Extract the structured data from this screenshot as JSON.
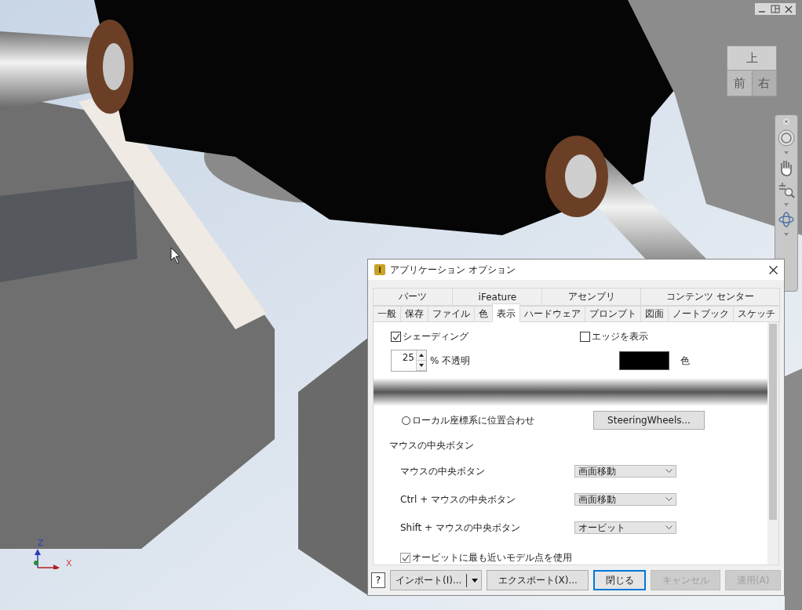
{
  "viewport": {
    "view_cube": {
      "top": "上",
      "front": "前",
      "right": "右"
    },
    "axes": {
      "z": "Z",
      "x": "X"
    }
  },
  "dialog": {
    "title": "アプリケーション オプション",
    "tab_groups": [
      {
        "label": "パーツ",
        "selected": false
      },
      {
        "label": "iFeature",
        "selected": false
      },
      {
        "label": "アセンブリ",
        "selected": false
      },
      {
        "label": "コンテンツ センター",
        "selected": false
      }
    ],
    "tabs": [
      {
        "label": "一般",
        "selected": false
      },
      {
        "label": "保存",
        "selected": false
      },
      {
        "label": "ファイル",
        "selected": false
      },
      {
        "label": "色",
        "selected": false
      },
      {
        "label": "表示",
        "selected": true
      },
      {
        "label": "ハードウェア",
        "selected": false
      },
      {
        "label": "プロンプト",
        "selected": false
      },
      {
        "label": "図面",
        "selected": false
      },
      {
        "label": "ノートブック",
        "selected": false
      },
      {
        "label": "スケッチ",
        "selected": false
      }
    ],
    "shading": {
      "label": "シェーディング",
      "checked": true
    },
    "opacity": {
      "value": "25",
      "label": "% 不透明"
    },
    "show_edges": {
      "label": "エッジを表示",
      "checked": false
    },
    "edge_color": {
      "color": "#000000",
      "label": "色"
    },
    "align_local": {
      "label": "ローカル座標系に位置合わせ",
      "selected": false
    },
    "steering_button": "SteeringWheels...",
    "middle_button_heading": "マウスの中央ボタン",
    "middle_button_rows": [
      {
        "label": "マウスの中央ボタン",
        "value": "画面移動"
      },
      {
        "label": "Ctrl + マウスの中央ボタン",
        "value": "画面移動"
      },
      {
        "label": "Shift + マウスの中央ボタン",
        "value": "オービット"
      }
    ],
    "orbit_nearest": {
      "label": "オービットに最も近いモデル点を使用",
      "checked": true
    },
    "help_button": "?",
    "buttons": [
      {
        "kind": "split",
        "label": "インポート(I)...",
        "disabled": false,
        "default": false
      },
      {
        "kind": "normal",
        "label": "エクスポート(X)...",
        "disabled": false,
        "default": false
      },
      {
        "kind": "normal",
        "label": "閉じる",
        "disabled": false,
        "default": true
      },
      {
        "kind": "normal",
        "label": "キャンセル",
        "disabled": true,
        "default": false
      },
      {
        "kind": "normal",
        "label": "適用(A)",
        "disabled": true,
        "default": false
      }
    ]
  }
}
